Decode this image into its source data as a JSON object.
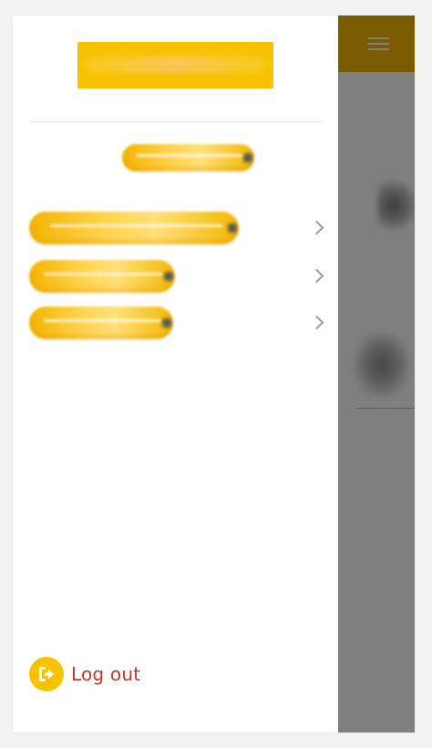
{
  "colors": {
    "brand_yellow": "#f7c300",
    "logout_text": "#c0392b",
    "overlay": "rgba(0,0,0,0.5)",
    "chevron": "#9a9a9a"
  },
  "drawer": {
    "menu_items": [
      {
        "icon": "chevron-right-icon"
      },
      {
        "icon": "chevron-right-icon"
      },
      {
        "icon": "chevron-right-icon"
      }
    ],
    "logout": {
      "label": "Log out",
      "icon": "logout-icon"
    }
  },
  "header": {
    "menu_icon": "hamburger-menu-icon"
  }
}
